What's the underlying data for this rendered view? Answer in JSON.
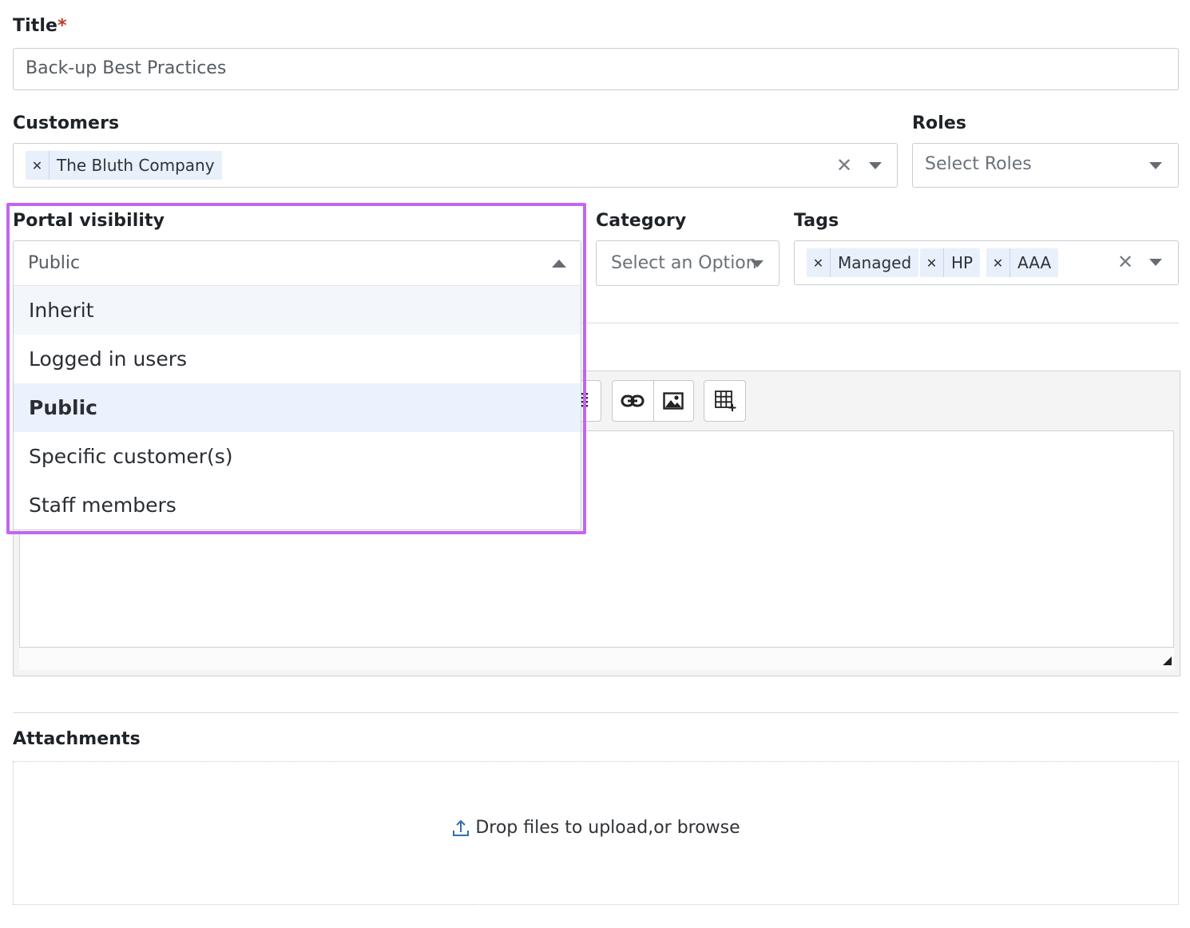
{
  "title_field": {
    "label": "Title",
    "required_mark": "*",
    "value": "Back-up Best Practices"
  },
  "customers": {
    "label": "Customers",
    "chips": [
      {
        "label": "The Bluth Company"
      }
    ],
    "clear_glyph": "✕"
  },
  "roles": {
    "label": "Roles",
    "placeholder": "Select Roles"
  },
  "portal_visibility": {
    "label": "Portal visibility",
    "selected": "Public",
    "options": [
      {
        "label": "Inherit",
        "state": "hover"
      },
      {
        "label": "Logged in users",
        "state": "normal"
      },
      {
        "label": "Public",
        "state": "selected"
      },
      {
        "label": "Specific customer(s)",
        "state": "normal"
      },
      {
        "label": "Staff members",
        "state": "normal"
      }
    ],
    "highlight_color": "#c266ee"
  },
  "category": {
    "label": "Category",
    "placeholder": "Select an Option"
  },
  "tags": {
    "label": "Tags",
    "chips": [
      {
        "label": "Managed"
      },
      {
        "label": "HP"
      },
      {
        "label": "AAA"
      }
    ],
    "clear_glyph": "✕"
  },
  "editor_toolbar": {
    "icons": [
      "align-icon",
      "link-icon",
      "image-icon",
      "table-insert-icon"
    ]
  },
  "attachments": {
    "label": "Attachments",
    "dropzone_text": "Drop files to upload,or browse",
    "icon": "upload-icon"
  },
  "colors": {
    "accent": "#c266ee",
    "chip_bg": "#e8f0fb",
    "required": "#c0392b",
    "upload_icon": "#2f6fb0"
  }
}
